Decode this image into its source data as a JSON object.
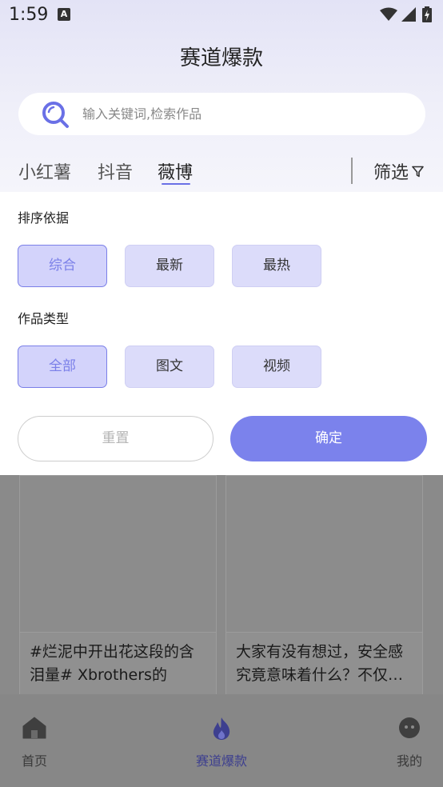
{
  "status_bar": {
    "time": "1:59",
    "notification_icon": "A"
  },
  "header": {
    "title": "赛道爆款"
  },
  "search": {
    "placeholder": "输入关键词,检索作品"
  },
  "tabs": [
    {
      "label": "小红薯",
      "active": false
    },
    {
      "label": "抖音",
      "active": false
    },
    {
      "label": "薇博",
      "active": true
    }
  ],
  "filter": {
    "label": "筛选"
  },
  "filter_panel": {
    "sort_title": "排序依据",
    "sort_options": [
      {
        "label": "综合",
        "selected": true
      },
      {
        "label": "最新",
        "selected": false
      },
      {
        "label": "最热",
        "selected": false
      }
    ],
    "type_title": "作品类型",
    "type_options": [
      {
        "label": "全部",
        "selected": true
      },
      {
        "label": "图文",
        "selected": false
      },
      {
        "label": "视频",
        "selected": false
      }
    ],
    "reset_label": "重置",
    "confirm_label": "确定"
  },
  "cards": [
    {
      "text": "#烂泥中开出花这段的含泪量# Xbrothers的《烂…"
    },
    {
      "text": "大家有没有想过，安全感究竟意味着什么？不仅…"
    }
  ],
  "bottom_nav": [
    {
      "label": "首页",
      "icon": "home-icon",
      "active": false
    },
    {
      "label": "赛道爆款",
      "icon": "fire-icon",
      "active": true
    },
    {
      "label": "我的",
      "icon": "profile-icon",
      "active": false
    }
  ],
  "colors": {
    "accent": "#7b82ec",
    "option_bg": "#dcdcfa",
    "header_gradient_top": "#e3e3f6"
  }
}
